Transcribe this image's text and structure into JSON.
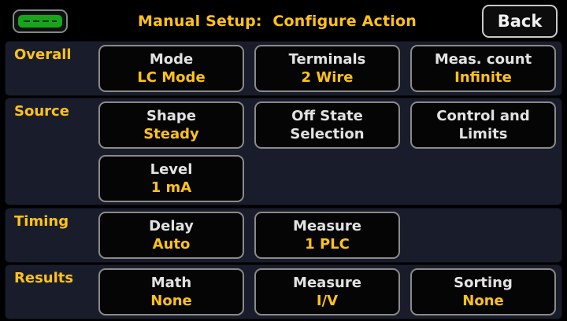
{
  "header": {
    "title": "Manual Setup:  Configure Action",
    "back_label": "Back",
    "battery_color": "#18a51c"
  },
  "sections": {
    "overall": {
      "label": "Overall",
      "mode": {
        "title": "Mode",
        "value": "LC Mode"
      },
      "terminals": {
        "title": "Terminals",
        "value": "2 Wire"
      },
      "meas_count": {
        "title": "Meas. count",
        "value": "Infinite"
      }
    },
    "source": {
      "label": "Source",
      "shape": {
        "title": "Shape",
        "value": "Steady"
      },
      "off_state": {
        "line1": "Off State",
        "line2": "Selection"
      },
      "control_limits": {
        "line1": "Control and",
        "line2": "Limits"
      },
      "level": {
        "title": "Level",
        "value": "1 mA"
      }
    },
    "timing": {
      "label": "Timing",
      "delay": {
        "title": "Delay",
        "value": "Auto"
      },
      "measure": {
        "title": "Measure",
        "value": "1 PLC"
      }
    },
    "results": {
      "label": "Results",
      "math": {
        "title": "Math",
        "value": "None"
      },
      "measure": {
        "title": "Measure",
        "value": "I/V"
      },
      "sorting": {
        "title": "Sorting",
        "value": "None"
      }
    }
  },
  "colors": {
    "accent": "#ffc21a",
    "panel": "#191d2b",
    "button_text": "#e2e2e2"
  }
}
